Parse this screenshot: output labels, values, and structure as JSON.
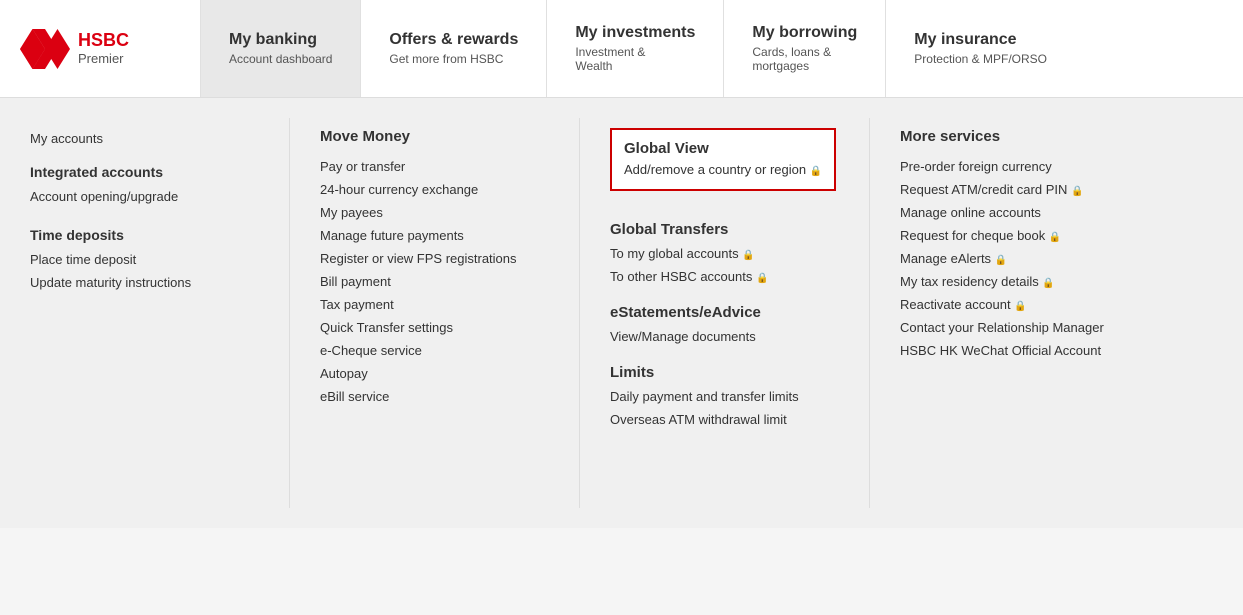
{
  "logo": {
    "brand": "HSBC",
    "sub": "Premier"
  },
  "nav": {
    "items": [
      {
        "id": "my-banking",
        "main": "My banking",
        "sub": "Account dashboard",
        "active": true
      },
      {
        "id": "offers-rewards",
        "main": "Offers & rewards",
        "sub": "Get more from HSBC",
        "active": false
      },
      {
        "id": "my-investments",
        "main": "My investments",
        "sub": "Investment &\nWealth",
        "active": false
      },
      {
        "id": "my-borrowing",
        "main": "My borrowing",
        "sub": "Cards, loans &\nmortgages",
        "active": false
      },
      {
        "id": "my-insurance",
        "main": "My insurance",
        "sub": "Protection & MPF/ORSO",
        "active": false
      }
    ]
  },
  "dropdown": {
    "col1": {
      "items_plain": [
        {
          "label": "My accounts",
          "bold": false
        },
        {
          "label": "Integrated accounts",
          "bold": true
        },
        {
          "label": "Account opening/upgrade",
          "bold": false
        },
        {
          "label": "Time deposits",
          "bold": true
        },
        {
          "label": "Place time deposit",
          "bold": false
        },
        {
          "label": "Update maturity instructions",
          "bold": false
        }
      ]
    },
    "col2": {
      "heading": "Move Money",
      "items": [
        {
          "label": "Pay or transfer",
          "lock": false
        },
        {
          "label": "24-hour currency exchange",
          "lock": false
        },
        {
          "label": "My payees",
          "lock": false
        },
        {
          "label": "Manage future payments",
          "lock": false
        },
        {
          "label": "Register or view FPS registrations",
          "lock": false
        },
        {
          "label": "Bill payment",
          "lock": false
        },
        {
          "label": "Tax payment",
          "lock": false
        },
        {
          "label": "Quick Transfer settings",
          "lock": false
        },
        {
          "label": "e-Cheque service",
          "lock": false
        },
        {
          "label": "Autopay",
          "lock": false
        },
        {
          "label": "eBill service",
          "lock": false
        }
      ]
    },
    "col3": {
      "globalView": {
        "title": "Global View",
        "desc": "Add/remove a country or region",
        "lock": true
      },
      "globalTransfers": {
        "heading": "Global Transfers",
        "items": [
          {
            "label": "To my global accounts",
            "lock": true
          },
          {
            "label": "To other HSBC accounts",
            "lock": true
          }
        ]
      },
      "eStatements": {
        "heading": "eStatements/eAdvice",
        "items": [
          {
            "label": "View/Manage documents",
            "lock": false
          }
        ]
      },
      "limits": {
        "heading": "Limits",
        "items": [
          {
            "label": "Daily payment and transfer limits",
            "lock": false
          },
          {
            "label": "Overseas ATM withdrawal limit",
            "lock": false
          }
        ]
      }
    },
    "col4": {
      "heading": "More services",
      "items": [
        {
          "label": "Pre-order foreign currency",
          "lock": false
        },
        {
          "label": "Request ATM/credit card PIN",
          "lock": true
        },
        {
          "label": "Manage online accounts",
          "lock": false
        },
        {
          "label": "Request for cheque book",
          "lock": true
        },
        {
          "label": "Manage eAlerts",
          "lock": true
        },
        {
          "label": "My tax residency details",
          "lock": true
        },
        {
          "label": "Reactivate account",
          "lock": true
        },
        {
          "label": "Contact your Relationship Manager",
          "lock": false
        },
        {
          "label": "HSBC HK WeChat Official Account",
          "lock": false
        }
      ]
    }
  }
}
